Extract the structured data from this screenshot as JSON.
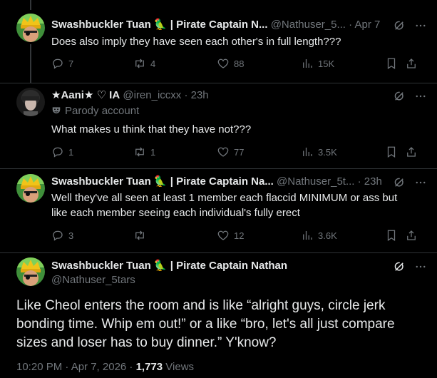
{
  "posts": [
    {
      "name": "Swashbuckler Tuan 🦜 | Pirate Captain N...",
      "handle": "@Nathuser_5...",
      "time": "· Apr 7",
      "text": "Does also imply they have seen each other's in full length???",
      "replies": "7",
      "reposts": "4",
      "likes": "88",
      "views": "15K"
    },
    {
      "name": "★Aani★ ♡ IA",
      "handle": "@iren_iccxx",
      "time": "· 23h",
      "parody": "Parody account",
      "text": "What makes u think that they have not???",
      "replies": "1",
      "reposts": "1",
      "likes": "77",
      "views": "3.5K"
    },
    {
      "name": "Swashbuckler Tuan 🦜 | Pirate Captain Na...",
      "handle": "@Nathuser_5t...",
      "time": "· 23h",
      "text": "Well they've all seen at least 1 member each flaccid MINIMUM or ass but like each member seeing each individual's fully erect",
      "replies": "3",
      "reposts": "",
      "likes": "12",
      "views": "3.6K"
    }
  ],
  "main": {
    "name": "Swashbuckler Tuan 🦜 | Pirate Captain Nathan",
    "handle": "@Nathuser_5tars",
    "text": "Like Cheol enters the room and is like “alright guys, circle jerk bonding time. Whip em out!” or a like “bro, let's all just compare sizes and loser has to buy dinner.” Y'know?",
    "timestamp": "10:20 PM · Apr 7, 2026 · ",
    "views_count": "1,773",
    "views_label": " Views"
  },
  "colors": {
    "background": "#000000",
    "text": "#e7e9ea",
    "muted": "#71767b",
    "divider": "#2f3336"
  },
  "icons": [
    "reply-icon",
    "repost-icon",
    "like-icon",
    "views-icon",
    "bookmark-icon",
    "share-icon",
    "grok-icon",
    "more-icon",
    "parody-mask-icon"
  ]
}
